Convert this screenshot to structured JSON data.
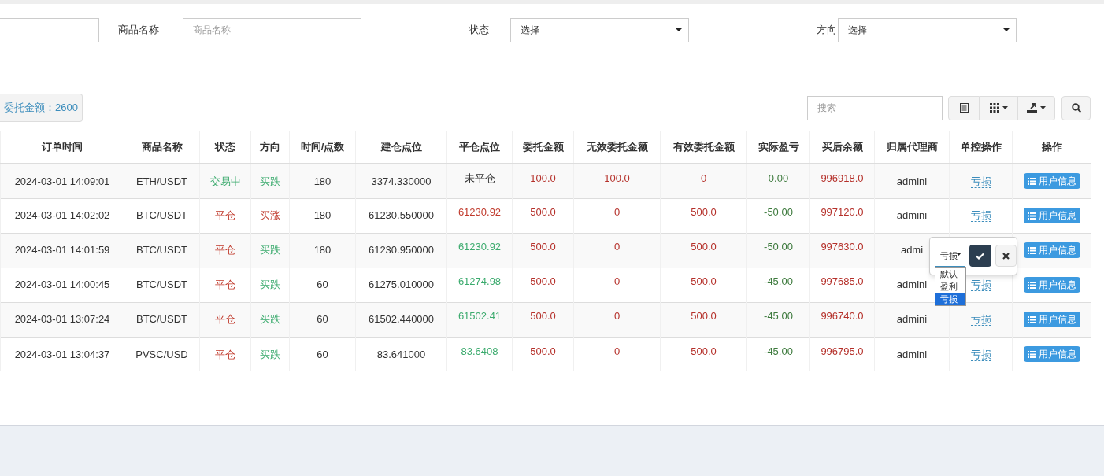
{
  "filters": [
    {
      "label": "商品名称",
      "kind": "input",
      "placeholder": "商品名称"
    },
    {
      "label": "状态",
      "kind": "select",
      "value": "选择"
    },
    {
      "label": "方向",
      "kind": "select",
      "value": "选择"
    }
  ],
  "summary": "委托金额：2600",
  "toolbar": {
    "search_placeholder": "搜索"
  },
  "table": {
    "columns": [
      "订单时间",
      "商品名称",
      "状态",
      "方向",
      "时间/点数",
      "建仓点位",
      "平仓点位",
      "委托金额",
      "无效委托金额",
      "有效委托金额",
      "实际盈亏",
      "买后余额",
      "归属代理商",
      "单控操作",
      "操作"
    ],
    "rows": [
      {
        "time": "2024-03-01 14:09:01",
        "product": "ETH/USDT",
        "status": {
          "text": "交易中",
          "color": "#3cab6e"
        },
        "direction": {
          "text": "买跌",
          "color": "#3cab6e"
        },
        "duration": "180",
        "open_price": "3374.330000",
        "close_price": {
          "text": "未平仓",
          "color": "#333333"
        },
        "amount": "100.0",
        "invalid_amount": "100.0",
        "valid_amount": "0",
        "pnl": "0.00",
        "balance": "996918.0",
        "agent": "admini",
        "control": "亏损",
        "action": "用户信息"
      },
      {
        "time": "2024-03-01 14:02:02",
        "product": "BTC/USDT",
        "status": {
          "text": "平仓",
          "color": "#c0392b"
        },
        "direction": {
          "text": "买涨",
          "color": "#c0392b"
        },
        "duration": "180",
        "open_price": "61230.550000",
        "close_price": {
          "text": "61230.92",
          "color": "#c0392b"
        },
        "amount": "500.0",
        "invalid_amount": "0",
        "valid_amount": "500.0",
        "pnl": "-50.00",
        "balance": "997120.0",
        "agent": "admini",
        "control": "亏损",
        "action": "用户信息"
      },
      {
        "time": "2024-03-01 14:01:59",
        "product": "BTC/USDT",
        "status": {
          "text": "平仓",
          "color": "#c0392b"
        },
        "direction": {
          "text": "买跌",
          "color": "#3cab6e"
        },
        "duration": "180",
        "open_price": "61230.950000",
        "close_price": {
          "text": "61230.92",
          "color": "#3cab6e"
        },
        "amount": "500.0",
        "invalid_amount": "0",
        "valid_amount": "500.0",
        "pnl": "-50.00",
        "balance": "997630.0",
        "agent": "admi",
        "action": "用户信息"
      },
      {
        "time": "2024-03-01 14:00:45",
        "product": "BTC/USDT",
        "status": {
          "text": "平仓",
          "color": "#c0392b"
        },
        "direction": {
          "text": "买跌",
          "color": "#3cab6e"
        },
        "duration": "60",
        "open_price": "61275.010000",
        "close_price": {
          "text": "61274.98",
          "color": "#3cab6e"
        },
        "amount": "500.0",
        "invalid_amount": "0",
        "valid_amount": "500.0",
        "pnl": "-45.00",
        "balance": "997685.0",
        "agent": "admini",
        "control": "亏损",
        "action": "用户信息",
        "editor": {
          "value": "亏损",
          "options": [
            {
              "label": "默认",
              "selected": false
            },
            {
              "label": "盈利",
              "selected": false
            },
            {
              "label": "亏损",
              "selected": true
            }
          ]
        }
      },
      {
        "time": "2024-03-01 13:07:24",
        "product": "BTC/USDT",
        "status": {
          "text": "平仓",
          "color": "#c0392b"
        },
        "direction": {
          "text": "买跌",
          "color": "#3cab6e"
        },
        "duration": "60",
        "open_price": "61502.440000",
        "close_price": {
          "text": "61502.41",
          "color": "#3cab6e"
        },
        "amount": "500.0",
        "invalid_amount": "0",
        "valid_amount": "500.0",
        "pnl": "-45.00",
        "balance": "996740.0",
        "agent": "admini",
        "control": "亏损",
        "action": "用户信息"
      },
      {
        "time": "2024-03-01 13:04:37",
        "product": "PVSC/USD",
        "status": {
          "text": "平仓",
          "color": "#c0392b"
        },
        "direction": {
          "text": "买跌",
          "color": "#3cab6e"
        },
        "duration": "60",
        "open_price": "83.641000",
        "close_price": {
          "text": "83.6408",
          "color": "#3cab6e"
        },
        "amount": "500.0",
        "invalid_amount": "0",
        "valid_amount": "500.0",
        "pnl": "-45.00",
        "balance": "996795.0",
        "agent": "admini",
        "control": "亏损",
        "action": "用户信息"
      }
    ]
  }
}
